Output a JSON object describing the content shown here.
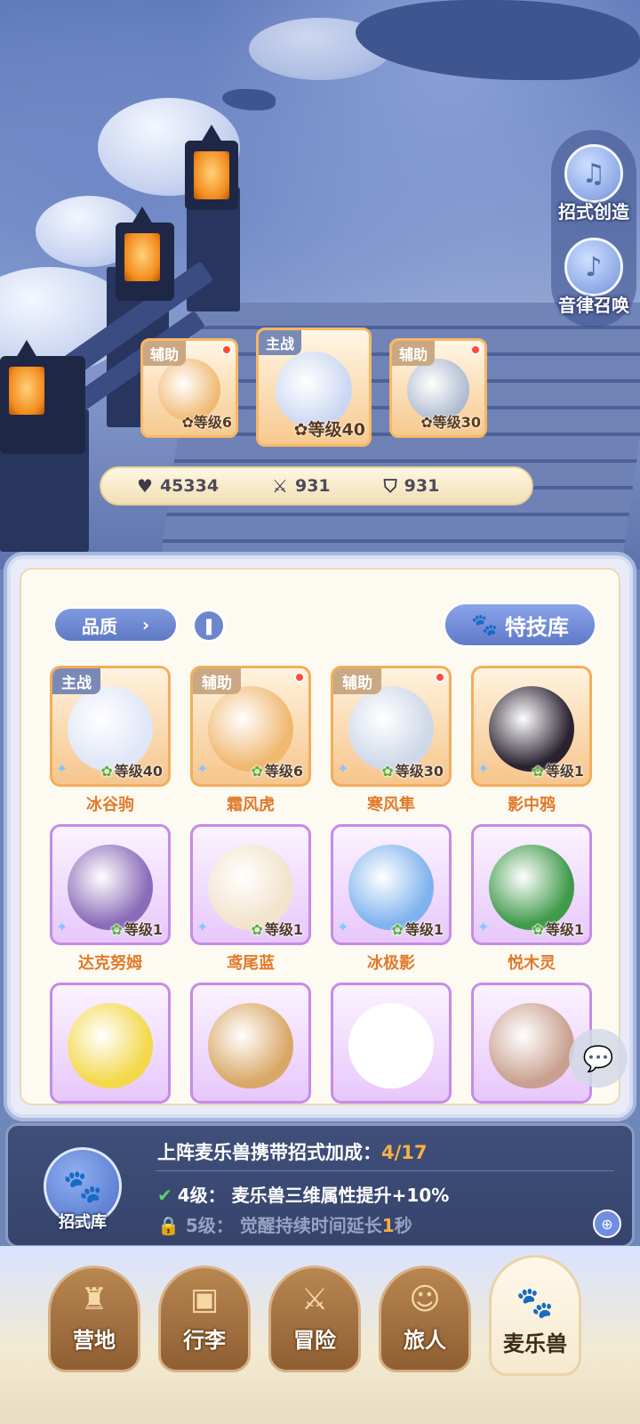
{
  "side_buttons": [
    {
      "label": "招式创造",
      "icon": "book-music-icon"
    },
    {
      "label": "音律召唤",
      "icon": "lyre-icon"
    }
  ],
  "team": [
    {
      "tag": "辅助",
      "level": "等级6",
      "has_dot": true
    },
    {
      "tag": "主战",
      "level": "等级40",
      "has_dot": false
    },
    {
      "tag": "辅助",
      "level": "等级30",
      "has_dot": true
    }
  ],
  "stats": {
    "hp": "45334",
    "attack": "931",
    "defense": "931"
  },
  "panel": {
    "filter_label": "品质",
    "skill_library_label": "特技库"
  },
  "creatures": [
    {
      "name": "冰谷驹",
      "tag": "主战",
      "level": "等级40",
      "rarity": "orange",
      "color": "#dfe6f7"
    },
    {
      "name": "霜风虎",
      "tag": "辅助",
      "level": "等级6",
      "rarity": "orange",
      "color": "#f0b870"
    },
    {
      "name": "寒风隼",
      "tag": "辅助",
      "level": "等级30",
      "rarity": "orange",
      "color": "#cfd8e8"
    },
    {
      "name": "影中鸦",
      "tag": "",
      "level": "等级1",
      "rarity": "orange",
      "color": "#2a2230"
    },
    {
      "name": "达克努姆",
      "tag": "",
      "level": "等级1",
      "rarity": "purple",
      "color": "#8a6bb8"
    },
    {
      "name": "鸢尾蓝",
      "tag": "",
      "level": "等级1",
      "rarity": "purple",
      "color": "#f2e3cc"
    },
    {
      "name": "冰极影",
      "tag": "",
      "level": "等级1",
      "rarity": "purple",
      "color": "#7fb3ee"
    },
    {
      "name": "悦木灵",
      "tag": "",
      "level": "等级1",
      "rarity": "purple",
      "color": "#3f9a4a"
    },
    {
      "name": "",
      "tag": "",
      "level": "",
      "rarity": "purple",
      "color": "#f3d84a"
    },
    {
      "name": "",
      "tag": "",
      "level": "",
      "rarity": "purple",
      "color": "#d9a766"
    },
    {
      "name": "",
      "tag": "",
      "level": "",
      "rarity": "purple",
      "color": "#ffffff"
    },
    {
      "name": "",
      "tag": "",
      "level": "",
      "rarity": "purple",
      "color": "#c9a08f"
    }
  ],
  "info": {
    "paw_label": "招式库",
    "title": "上阵麦乐兽携带招式加成：",
    "count": "4/17",
    "row1_level": "4级：",
    "row1_text": "麦乐兽三维属性提升+10%",
    "row2_level": "5级：",
    "row2_text_a": "觉醒持续时间延长",
    "row2_hl": "1",
    "row2_text_b": "秒"
  },
  "nav": [
    {
      "label": "营地",
      "icon": "castle-icon"
    },
    {
      "label": "行李",
      "icon": "backpack-icon"
    },
    {
      "label": "冒险",
      "icon": "crossed-swords-icon"
    },
    {
      "label": "旅人",
      "icon": "traveler-icon"
    },
    {
      "label": "麦乐兽",
      "icon": "pet-icon",
      "active": true
    }
  ]
}
